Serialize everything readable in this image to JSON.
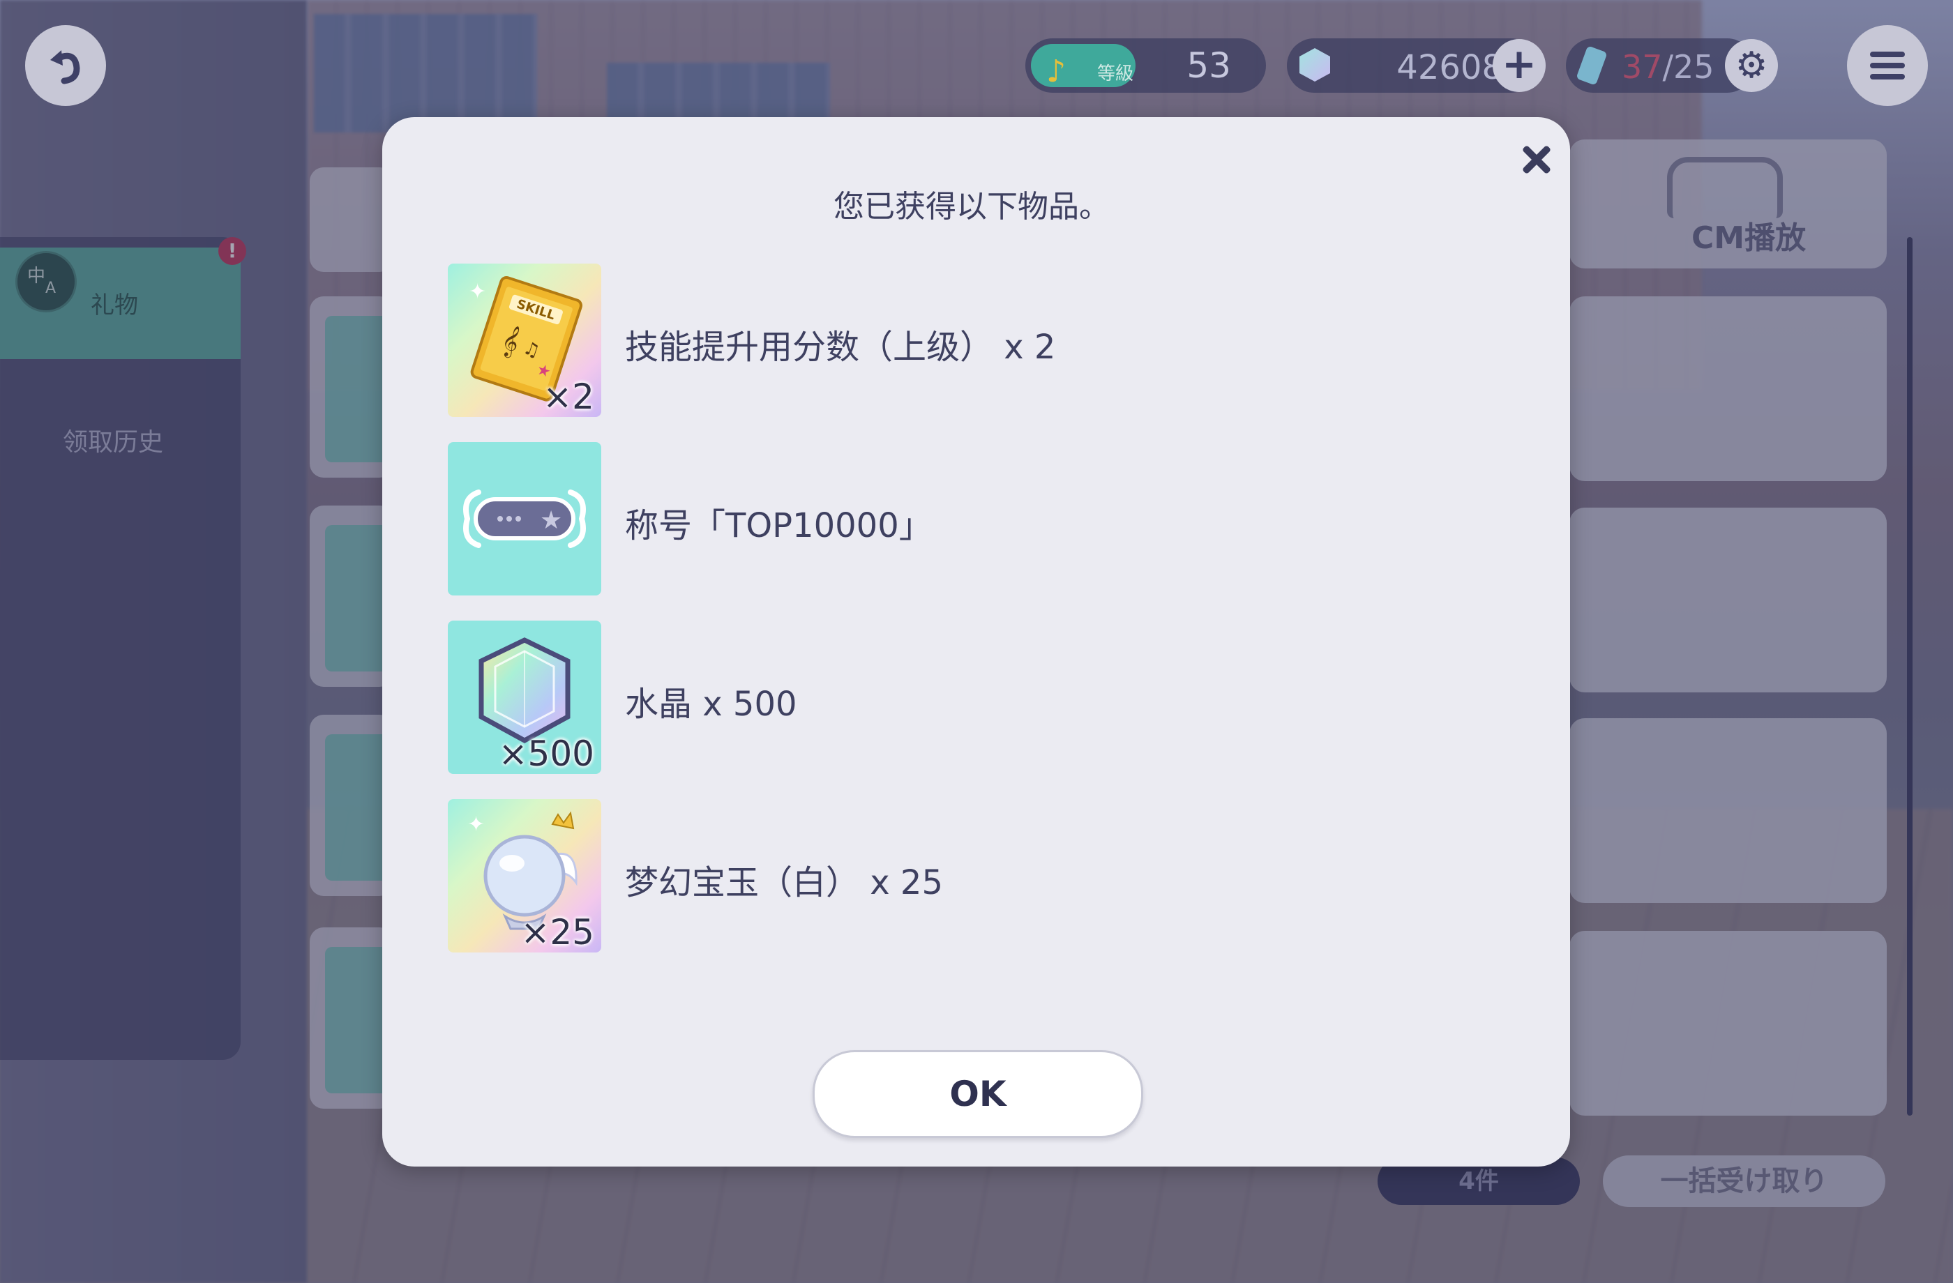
{
  "hud": {
    "level_label": "等級",
    "level_value": "53",
    "crystal_value": "42608",
    "stamina_current": "37",
    "stamina_max": "/25"
  },
  "side": {
    "gift_tab": "礼物",
    "history_tab": "领取历史",
    "gift_alert": "!"
  },
  "right_panel": {
    "cm_label": "CM播放",
    "count": "4件",
    "bulk_claim": "一括受け取り"
  },
  "modal": {
    "title": "您已获得以下物品。",
    "items": [
      {
        "name": "技能提升用分数（上级） x 2",
        "qty": "×2",
        "icon": "skill-score-icon"
      },
      {
        "name": "称号「TOP10000」",
        "qty": "",
        "icon": "title-badge-icon"
      },
      {
        "name": "水晶 x 500",
        "qty": "×500",
        "icon": "crystal-icon"
      },
      {
        "name": "梦幻宝玉（白） x 25",
        "qty": "×25",
        "icon": "dream-orb-icon"
      }
    ],
    "ok_label": "OK"
  },
  "colors": {
    "teal": "#5fb2a6",
    "modal_bg": "#ebebf2",
    "text": "#3e4060"
  }
}
